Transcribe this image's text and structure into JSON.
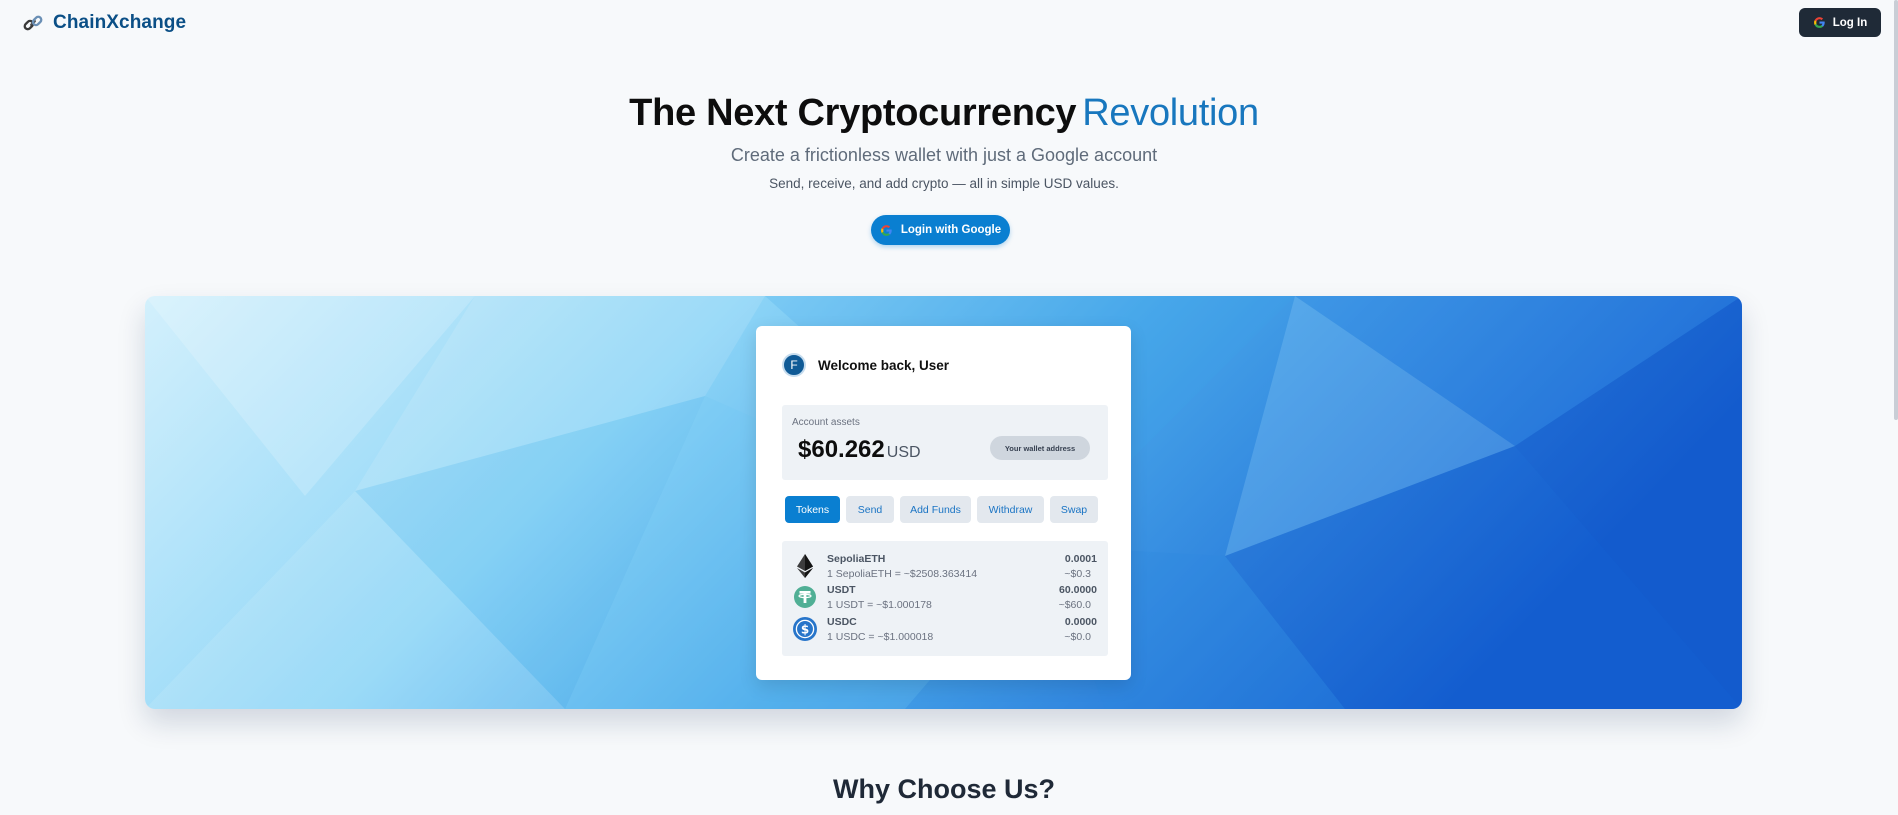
{
  "header": {
    "brand": "ChainXchange",
    "login_label": "Log In"
  },
  "hero": {
    "title_main": "The Next Cryptocurrency",
    "title_accent": "Revolution",
    "subtitle": "Create a frictionless wallet with just a Google account",
    "description": "Send, receive, and add crypto — all in simple USD values.",
    "google_button": "Login with Google"
  },
  "wallet": {
    "avatar_initial": "F",
    "welcome": "Welcome back, User",
    "assets_label": "Account assets",
    "assets_amount": "$60.262",
    "assets_unit": "USD",
    "address_button": "Your wallet address",
    "tabs": [
      {
        "label": "Tokens",
        "active": true
      },
      {
        "label": "Send",
        "active": false
      },
      {
        "label": "Add Funds",
        "active": false
      },
      {
        "label": "Withdraw",
        "active": false
      },
      {
        "label": "Swap",
        "active": false
      }
    ],
    "tokens": [
      {
        "name": "SepoliaETH",
        "rate": "1 SepoliaETH = ~$2508.363414",
        "balance": "0.0001",
        "usd": "~$0.3",
        "icon": "ethereum-icon"
      },
      {
        "name": "USDT",
        "rate": "1 USDT = ~$1.000178",
        "balance": "60.0000",
        "usd": "~$60.0",
        "icon": "tether-icon"
      },
      {
        "name": "USDC",
        "rate": "1 USDC = ~$1.000018",
        "balance": "0.0000",
        "usd": "~$0.0",
        "icon": "usdc-icon"
      }
    ]
  },
  "section": {
    "why_title": "Why Choose Us?"
  },
  "colors": {
    "brand": "#0b4f86",
    "accent": "#1877be",
    "primary_button": "#0a7fd1",
    "dark_button": "#1f2a37"
  }
}
